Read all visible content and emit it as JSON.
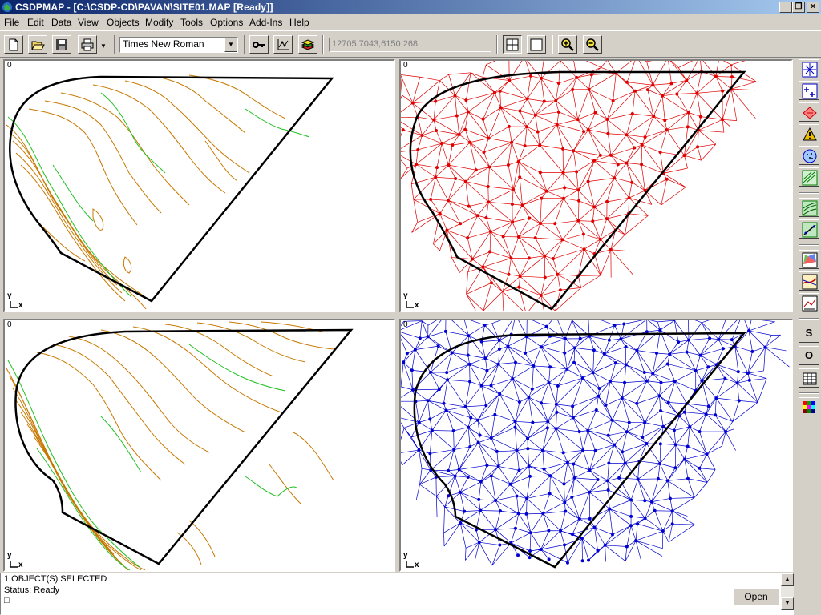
{
  "window": {
    "title": "CSDPMAP - [C:\\CSDP-CD\\PAVAN\\SITE01.MAP [Ready]]",
    "minimize_label": "_",
    "restore_label": "❐",
    "close_label": "×"
  },
  "menu": [
    "File",
    "Edit",
    "Data",
    "View",
    "Objects",
    "Modify",
    "Tools",
    "Options",
    "Add-Ins",
    "Help"
  ],
  "toolbar": {
    "font_name": "Times New Roman",
    "coordinates": "12705.7043,6150.268"
  },
  "panes": {
    "top_left": {
      "origin_label": "0",
      "y_label": "y",
      "x_label": "x"
    },
    "top_right": {
      "origin_label": "0",
      "y_label": "y",
      "x_label": "x"
    },
    "bottom_left": {
      "origin_label": "0",
      "y_label": "y",
      "x_label": "x"
    },
    "bottom_right": {
      "origin_label": "0",
      "y_label": "y",
      "x_label": "x"
    }
  },
  "right_toolbar": {
    "s_label": "S",
    "o_label": "O"
  },
  "status": {
    "line1": "1 OBJECT(S) SELECTED",
    "line2": "Status: Ready",
    "line3": "□",
    "open_label": "Open"
  },
  "colors": {
    "title_gradient_start": "#0a246a",
    "title_gradient_end": "#a6caf0",
    "contour_orange": "#c87800",
    "contour_green": "#20c020",
    "tin_red": "#e00000",
    "tin_blue": "#0000d0",
    "boundary": "#000000"
  }
}
